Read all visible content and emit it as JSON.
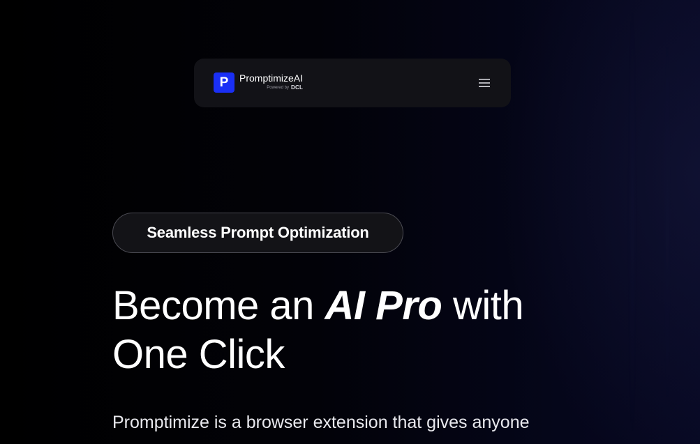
{
  "colors": {
    "background": "#000000",
    "navbar_bg": "#121217",
    "brand_blue": "#1a2ff5",
    "pill_border": "#4a4a52",
    "text": "#ffffff"
  },
  "navbar": {
    "logo_letter": "P",
    "brand_name": "PromptimizeAI",
    "powered_by": "Powered by",
    "powered_brand": "DCL",
    "menu_icon": "hamburger-menu-icon"
  },
  "hero": {
    "badge_label": "Seamless Prompt Optimization",
    "headline_part1": "Become an ",
    "headline_emphasis": "AI Pro",
    "headline_part2": " with One Click",
    "description": "Promptimize is a browser extension that gives anyone"
  }
}
